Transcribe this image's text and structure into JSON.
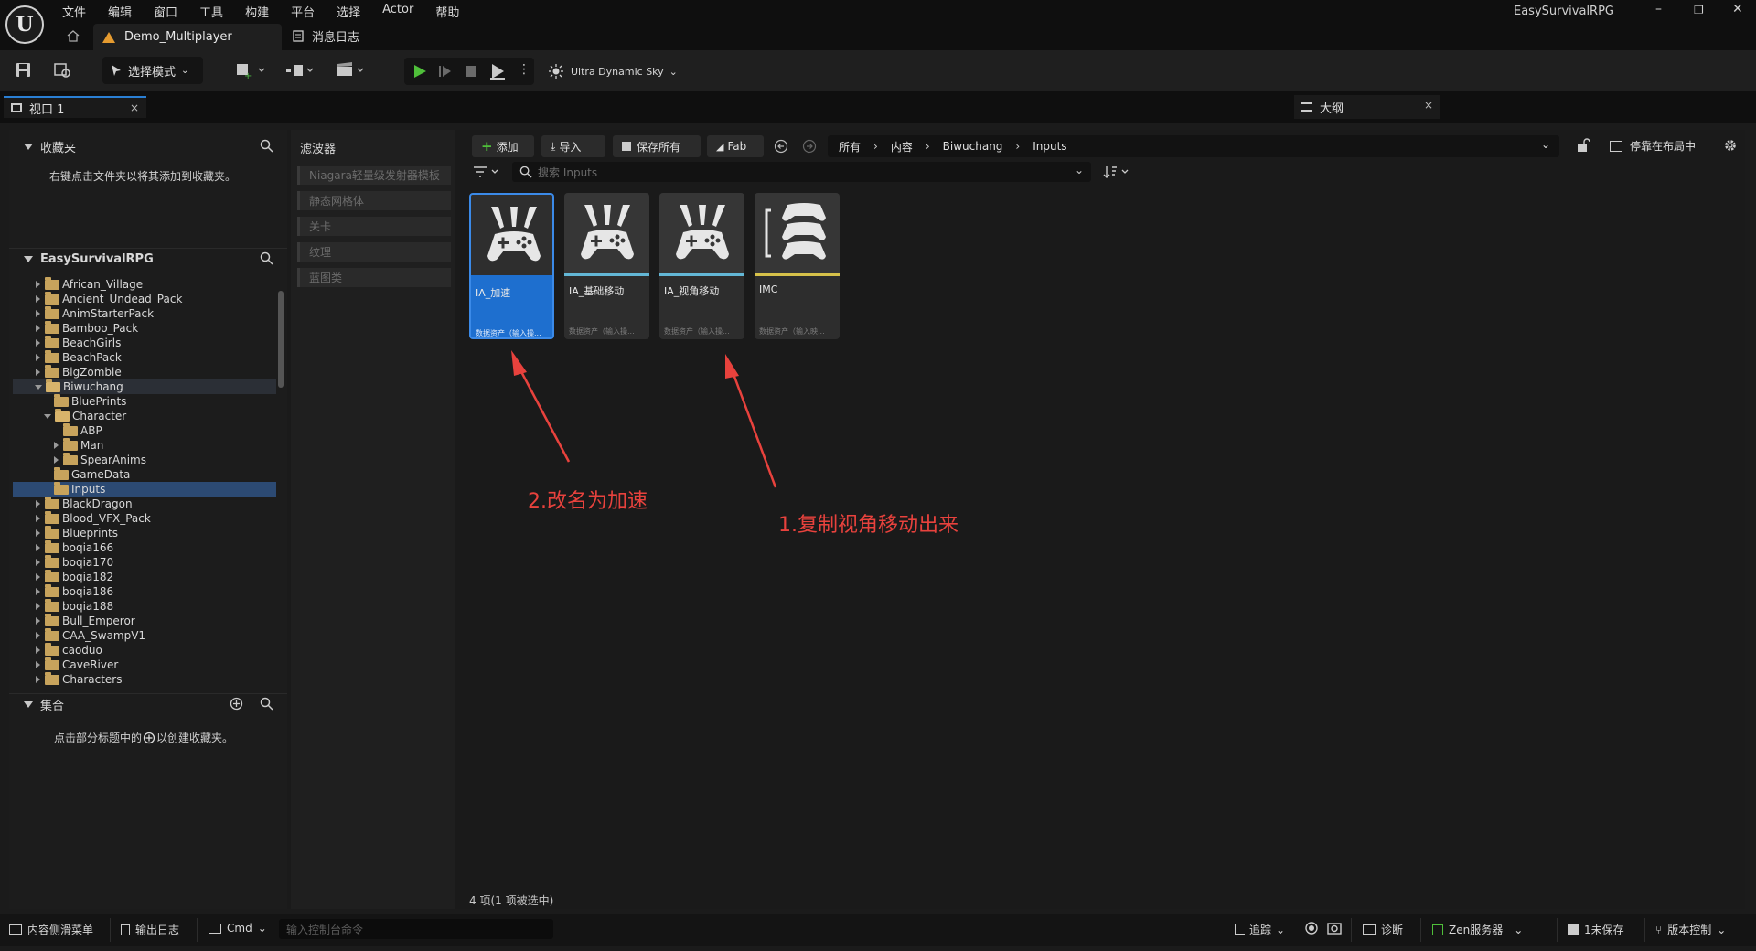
{
  "menu": {
    "items": [
      "文件",
      "编辑",
      "窗口",
      "工具",
      "构建",
      "平台",
      "选择",
      "Actor",
      "帮助"
    ]
  },
  "window": {
    "app_name": "EasySurvivalRPG",
    "doc_tab": "Demo_Multiplayer",
    "log_tab": "消息日志",
    "minimize": "–",
    "restore": "❐",
    "close": "✕"
  },
  "toolbar": {
    "mode_label": "选择模式",
    "sky_label": "Ultra Dynamic Sky"
  },
  "tabs": {
    "viewport": "视口 1",
    "outline": "大纲",
    "close": "×"
  },
  "favorites": {
    "title": "收藏夹",
    "hint": "右键点击文件夹以将其添加到收藏夹。"
  },
  "project": {
    "title": "EasySurvivalRPG",
    "tree": [
      {
        "label": "African_Village",
        "depth": 0,
        "caret": "right"
      },
      {
        "label": "Ancient_Undead_Pack",
        "depth": 0,
        "caret": "right"
      },
      {
        "label": "AnimStarterPack",
        "depth": 0,
        "caret": "right"
      },
      {
        "label": "Bamboo_Pack",
        "depth": 0,
        "caret": "right"
      },
      {
        "label": "BeachGirls",
        "depth": 0,
        "caret": "right"
      },
      {
        "label": "BeachPack",
        "depth": 0,
        "caret": "right"
      },
      {
        "label": "BigZombie",
        "depth": 0,
        "caret": "right"
      },
      {
        "label": "Biwuchang",
        "depth": 0,
        "caret": "down",
        "state": "open"
      },
      {
        "label": "BluePrints",
        "depth": 1,
        "caret": "none"
      },
      {
        "label": "Character",
        "depth": 1,
        "caret": "down"
      },
      {
        "label": "ABP",
        "depth": 2,
        "caret": "none"
      },
      {
        "label": "Man",
        "depth": 2,
        "caret": "right"
      },
      {
        "label": "SpearAnims",
        "depth": 2,
        "caret": "right"
      },
      {
        "label": "GameData",
        "depth": 1,
        "caret": "none"
      },
      {
        "label": "Inputs",
        "depth": 1,
        "caret": "none",
        "state": "selected"
      },
      {
        "label": "BlackDragon",
        "depth": 0,
        "caret": "right"
      },
      {
        "label": "Blood_VFX_Pack",
        "depth": 0,
        "caret": "right"
      },
      {
        "label": "Blueprints",
        "depth": 0,
        "caret": "right"
      },
      {
        "label": "boqia166",
        "depth": 0,
        "caret": "right"
      },
      {
        "label": "boqia170",
        "depth": 0,
        "caret": "right"
      },
      {
        "label": "boqia182",
        "depth": 0,
        "caret": "right"
      },
      {
        "label": "boqia186",
        "depth": 0,
        "caret": "right"
      },
      {
        "label": "boqia188",
        "depth": 0,
        "caret": "right"
      },
      {
        "label": "Bull_Emperor",
        "depth": 0,
        "caret": "right"
      },
      {
        "label": "CAA_SwampV1",
        "depth": 0,
        "caret": "right"
      },
      {
        "label": "caoduo",
        "depth": 0,
        "caret": "right"
      },
      {
        "label": "CaveRiver",
        "depth": 0,
        "caret": "right"
      },
      {
        "label": "Characters",
        "depth": 0,
        "caret": "right"
      }
    ]
  },
  "collections": {
    "title": "集合",
    "hint_before": "点击部分标题中的",
    "hint_after": "以创建收藏夹。"
  },
  "filters": {
    "title": "滤波器",
    "items": [
      "Niagara轻量级发射器模板",
      "静态网格体",
      "关卡",
      "纹理",
      "蓝图类"
    ]
  },
  "content_toolbar": {
    "add": "添加",
    "import": "导入",
    "save_all": "保存所有",
    "fab": "Fab",
    "breadcrumb": [
      "所有",
      "内容",
      "Biwuchang",
      "Inputs"
    ],
    "dock": "停靠在布局中",
    "search_placeholder": "搜索 Inputs"
  },
  "assets": [
    {
      "name": "IA_加速",
      "type": "数据资产（输入操...",
      "strip": "#1e6fcf",
      "selected": true
    },
    {
      "name": "IA_基础移动",
      "type": "数据资产（输入操...",
      "strip": "#63b7d6",
      "selected": false
    },
    {
      "name": "IA_视角移动",
      "type": "数据资产（输入操...",
      "strip": "#63b7d6",
      "selected": false
    },
    {
      "name": "IMC",
      "type": "数据资产（输入映...",
      "strip": "#d6c14a",
      "selected": false
    }
  ],
  "count_label": "4 项(1 项被选中)",
  "annotations": {
    "rename": "2.改名为加速",
    "copy": "1.复制视角移动出来",
    "color": "#e8423d"
  },
  "statusbar": {
    "content_drawer": "内容侧滑菜单",
    "output_log": "输出日志",
    "cmd": "Cmd",
    "console_placeholder": "输入控制台命令",
    "trace": "追踪",
    "diagnostics": "诊断",
    "zen": "Zen服务器",
    "unsaved": "1未保存",
    "source_control": "版本控制"
  }
}
